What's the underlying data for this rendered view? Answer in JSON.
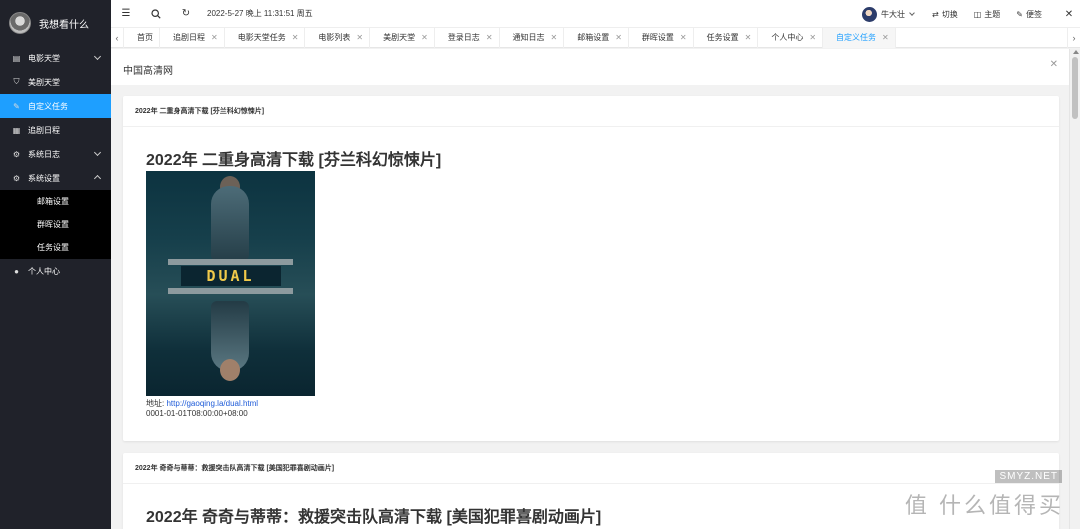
{
  "sidebar": {
    "brand": "我想看什么",
    "items": [
      {
        "label": "电影天堂",
        "icon": "document-icon"
      },
      {
        "label": "美剧天堂",
        "icon": "shield-icon"
      },
      {
        "label": "自定义任务",
        "icon": "edit-icon"
      },
      {
        "label": "追剧日程",
        "icon": "calendar-icon"
      },
      {
        "label": "系统日志",
        "icon": "gear-icon"
      },
      {
        "label": "系统设置",
        "icon": "gear-icon"
      },
      {
        "label": "个人中心",
        "icon": "user-icon"
      }
    ],
    "sub_items": [
      "邮箱设置",
      "群晖设置",
      "任务设置"
    ]
  },
  "header": {
    "datetime": "2022-5-27 晚上 11:31:51 周五",
    "user": "牛大壮",
    "switch_label": "切换",
    "theme_label": "主题",
    "note_label": "便签"
  },
  "tabs": [
    "首页",
    "追剧日程",
    "电影天堂任务",
    "电影列表",
    "美剧天堂",
    "登录日志",
    "通知日志",
    "邮箱设置",
    "群晖设置",
    "任务设置",
    "个人中心",
    "自定义任务"
  ],
  "page": {
    "title": "中国高清网"
  },
  "cards": [
    {
      "header": "2022年 二重身高清下载 [芬兰科幻惊悚片]",
      "title": "2022年 二重身高清下载 [芬兰科幻惊悚片]",
      "poster_title": "DUAL",
      "address_label": "地址:",
      "url": "http://gaoqing.la/dual.html",
      "date": "0001-01-01T08:00:00+08:00"
    },
    {
      "header": "2022年 奇奇与蒂蒂：救援突击队高清下载 [美国犯罪喜剧动画片]",
      "title": "2022年 奇奇与蒂蒂：救援突击队高清下载 [美国犯罪喜剧动画片]"
    }
  ],
  "watermark": {
    "site": "SMYZ.NET",
    "brand": "值 什么值得买"
  },
  "colors": {
    "accent": "#1e9fff",
    "sidebar": "#20222a",
    "link": "#1e5bd8"
  }
}
